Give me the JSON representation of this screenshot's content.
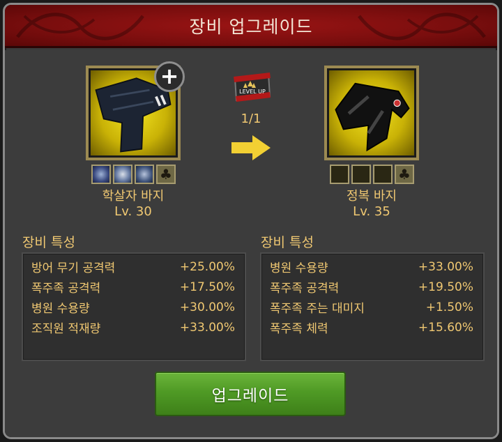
{
  "window": {
    "title": "장비 업그레이드"
  },
  "current_item": {
    "name": "학살자 바지",
    "level": "Lv. 30",
    "add_icon": "plus-icon",
    "slots": [
      "gem-a",
      "gem-b",
      "gem-c",
      "club"
    ]
  },
  "target_item": {
    "name": "정복 바지",
    "level": "Lv. 35",
    "slots": [
      "empty",
      "empty",
      "empty",
      "club"
    ]
  },
  "level_up": {
    "badge_text": "LEVEL UP",
    "count": "1/1"
  },
  "current_stats": {
    "title": "장비 특성",
    "rows": [
      {
        "label": "방어 무기 공격력",
        "value": "+25.00%"
      },
      {
        "label": "폭주족 공격력",
        "value": "+17.50%"
      },
      {
        "label": "병원 수용량",
        "value": "+30.00%"
      },
      {
        "label": "조직원 적재량",
        "value": "+33.00%"
      }
    ]
  },
  "target_stats": {
    "title": "장비 특성",
    "rows": [
      {
        "label": "병원 수용량",
        "value": "+33.00%"
      },
      {
        "label": "폭주족 공격력",
        "value": "+19.50%"
      },
      {
        "label": "폭주족 주는 대미지",
        "value": "+1.50%"
      },
      {
        "label": "폭주족 체력",
        "value": "+15.60%"
      }
    ]
  },
  "actions": {
    "upgrade_label": "업그레이드"
  },
  "colors": {
    "accent": "#f0c872",
    "header": "#8a1010",
    "button": "#4f9a25"
  }
}
